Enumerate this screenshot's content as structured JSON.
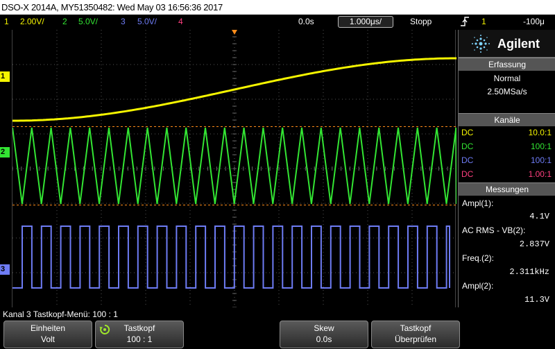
{
  "title_bar": "DSO-X 2014A, MY51350482: Wed May 03 16:56:36 2017",
  "status": {
    "ch1_num": "1",
    "ch1_scale": "2.00V/",
    "ch2_num": "2",
    "ch2_scale": "5.0V/",
    "ch3_num": "3",
    "ch3_scale": "5.0V/",
    "ch4_num": "4",
    "delay": "0.0s",
    "timebase": "1.000μs/",
    "run_state": "Stopp",
    "trig_channel": "1",
    "trig_level": "-100μ"
  },
  "channel_markers": {
    "ch1": "1",
    "ch2": "2",
    "ch3": "3"
  },
  "brand": "Agilent",
  "acquisition": {
    "header": "Erfassung",
    "mode": "Normal",
    "rate": "2.50MSa/s"
  },
  "channels_panel": {
    "header": "Kanäle",
    "rows": [
      {
        "coupling": "DC",
        "probe": "10.0:1",
        "color": "#f5f500"
      },
      {
        "coupling": "DC",
        "probe": "100:1",
        "color": "#33e533"
      },
      {
        "coupling": "DC",
        "probe": "100:1",
        "color": "#6e7cf5"
      },
      {
        "coupling": "DC",
        "probe": "1.00:1",
        "color": "#ff3f7f"
      }
    ]
  },
  "measurements": {
    "header": "Messungen",
    "items": [
      {
        "label": "Ampl(1):",
        "value": "4.1V"
      },
      {
        "label": "AC RMS - VB(2):",
        "value": "2.837V"
      },
      {
        "label": "Freq.(2):",
        "value": "2.311kHz"
      },
      {
        "label": "Ampl(2):",
        "value": "11.3V"
      }
    ]
  },
  "menu_title": "Kanal 3 Tastkopf-Menü: 100 : 1",
  "softkeys": [
    {
      "line1": "Einheiten",
      "line2": "Volt"
    },
    {
      "line1": "Tastkopf",
      "line2": "100 : 1"
    },
    {
      "line1": "Skew",
      "line2": "0.0s"
    },
    {
      "line1": "Tastkopf",
      "line2": "Überprüfen"
    }
  ],
  "colors": {
    "ch1": "#f5f500",
    "ch2": "#33e533",
    "ch3": "#6e7cf5",
    "ch4": "#ff3f7f",
    "trigger": "#ff8c1a"
  }
}
